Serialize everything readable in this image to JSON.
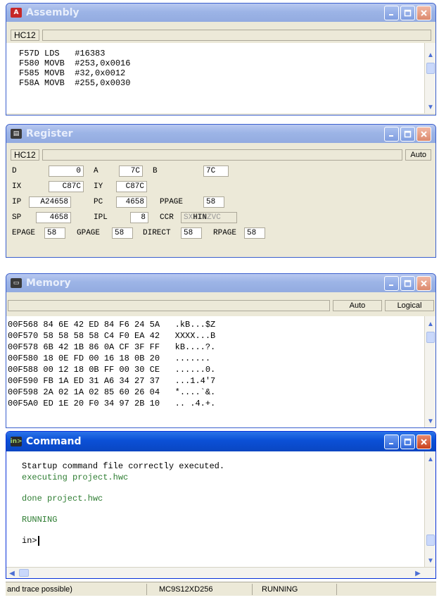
{
  "assembly": {
    "title": "Assembly",
    "icon": "A",
    "tab": "HC12",
    "lines": [
      "F57D LDS   #16383",
      "F580 MOVB  #253,0x0016",
      "F585 MOVB  #32,0x0012",
      "F58A MOVB  #255,0x0030"
    ]
  },
  "register": {
    "title": "Register",
    "tab": "HC12",
    "mode": "Auto",
    "regs": {
      "d_label": "D",
      "d_val": "0",
      "a_label": "A",
      "a_val": "7C",
      "b_label": "B",
      "b_val": "7C",
      "ix_label": "IX",
      "ix_val": "C87C",
      "iy_label": "IY",
      "iy_val": "C87C",
      "ip_label": "IP",
      "ip_val": "A24658",
      "pc_label": "PC",
      "pc_val": "4658",
      "ppage_label": "PPAGE",
      "ppage_val": "58",
      "sp_label": "SP",
      "sp_val": "4658",
      "ipl_label": "IPL",
      "ipl_val": "8",
      "ccr_label": "CCR",
      "ccr_faded1": "SX",
      "ccr_bold": "HIN",
      "ccr_faded2": "ZVC",
      "epage_label": "EPAGE",
      "epage_val": "58",
      "gpage_label": "GPAGE",
      "gpage_val": "58",
      "direct_label": "DIRECT",
      "direct_val": "58",
      "rpage_label": "RPAGE",
      "rpage_val": "58"
    }
  },
  "memory": {
    "title": "Memory",
    "mode": "Auto",
    "view": "Logical",
    "rows": [
      "00F568 84 6E 42 ED 84 F6 24 5A   .kB...$Z",
      "00F570 58 58 58 58 C4 F0 EA 42   XXXX...B",
      "00F578 6B 42 1B 86 0A CF 3F FF   kB....?.",
      "00F580 18 0E FD 00 16 18 0B 20   .......",
      "00F588 00 12 18 0B FF 00 30 CE   ......0.",
      "00F590 FB 1A ED 31 A6 34 27 37   ...1.4'7",
      "00F598 2A 02 1A 02 85 60 26 04   *....`&.",
      "00F5A0 ED 1E 20 F0 34 97 2B 10   .. .4.+."
    ]
  },
  "command": {
    "title": "Command",
    "line1": "Startup command file correctly executed.",
    "line2": "executing project.hwc",
    "line3": "done project.hwc",
    "line4": "RUNNING",
    "prompt": "in>"
  },
  "statusbar": {
    "hint": "and trace possible)",
    "device": "MC9S12XD256",
    "state": "RUNNING"
  }
}
